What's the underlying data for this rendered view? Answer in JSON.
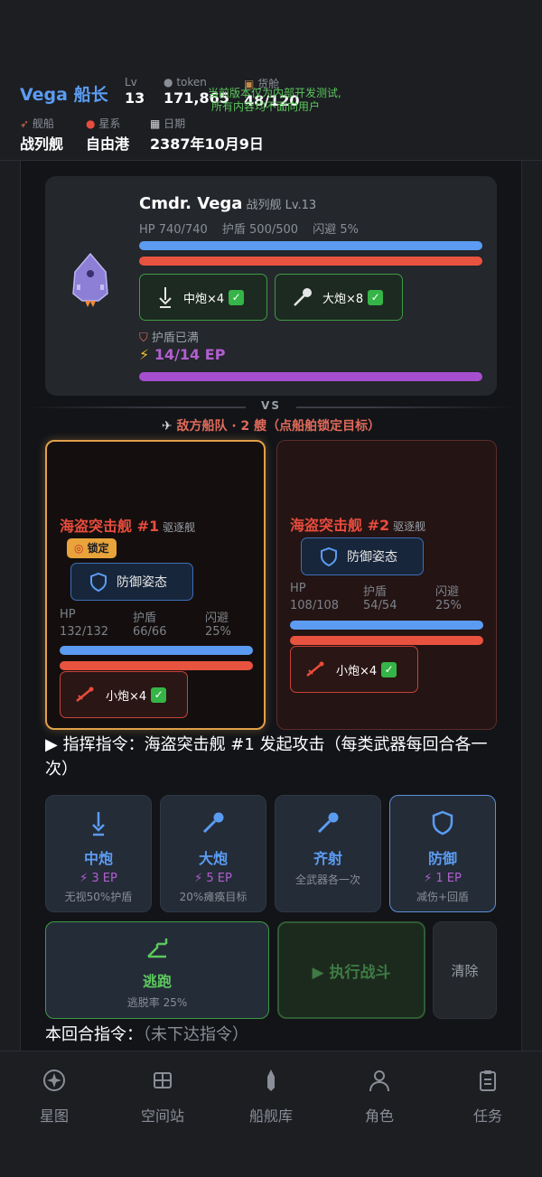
{
  "header": {
    "captain_name": "Vega 船长",
    "lv_label": "Lv",
    "lv_value": "13",
    "token_label": "token",
    "token_value": "171,865",
    "cargo_label": "货舱",
    "cargo_value": "48/120",
    "ship_label": "舰船",
    "ship_value": "战列舰",
    "system_label": "星系",
    "system_value": "自由港",
    "date_label": "日期",
    "date_value": "2387年10月9日",
    "notice_line1": "当前版本仅为内部开发测试,",
    "notice_line2": "所有内容均不面向用户"
  },
  "player": {
    "name": "Cmdr. Vega",
    "ship_info": "战列舰 Lv.13",
    "hp": "HP 740/740",
    "shield": "护盾 500/500",
    "evade": "闪避 5%",
    "hp_fraction": 1.0,
    "shield_fraction": 1.0,
    "weapons": [
      {
        "label": "中炮×4",
        "check": "✓"
      },
      {
        "label": "大炮×8",
        "check": "✓"
      }
    ],
    "shield_status": "护盾已满",
    "ep": "14/14 EP",
    "ep_fraction": 1.0
  },
  "vs_label": "VS",
  "enemy_header": "敌方船队 · 2 艘（点船舶锁定目标）",
  "enemies": [
    {
      "name": "海盗突击舰 #1",
      "class": "驱逐舰",
      "lock_label": "锁定",
      "stance": "防御姿态",
      "hp_label": "HP",
      "hp_value": "132/132",
      "shield_label": "护盾",
      "shield_value": "66/66",
      "evade_label": "闪避",
      "evade_value": "25%",
      "weapon": "小炮×4",
      "check": "✓"
    },
    {
      "name": "海盗突击舰 #2",
      "class": "驱逐舰",
      "stance": "防御姿态",
      "hp_label": "HP",
      "hp_value": "108/108",
      "shield_label": "护盾",
      "shield_value": "54/54",
      "evade_label": "闪避",
      "evade_value": "25%",
      "weapon": "小炮×4",
      "check": "✓"
    }
  ],
  "command_line": "▶ 指挥指令：海盗突击舰 #1 发起攻击（每类武器每回合各一次）",
  "actions": [
    {
      "title": "中炮",
      "cost": "⚡ 3 EP",
      "desc": "无视50%护盾",
      "icon": "medium-cannon-icon"
    },
    {
      "title": "大炮",
      "cost": "⚡ 5 EP",
      "desc": "20%瘫痪目标",
      "icon": "large-cannon-icon"
    },
    {
      "title": "齐射",
      "cost": "全武器各一次",
      "desc": "",
      "icon": "volley-icon"
    },
    {
      "title": "防御",
      "cost": "⚡ 1 EP",
      "desc": "减伤+回盾",
      "icon": "shield-icon"
    }
  ],
  "escape": {
    "title": "逃跑",
    "desc": "逃脱率 25%"
  },
  "execute_label": "▶ 执行战斗",
  "clear_label": "清除",
  "round_cmd_label": "本回合指令：",
  "round_cmd_value": "（未下达指令）",
  "nav": [
    {
      "label": "星图",
      "icon": "star-map-icon"
    },
    {
      "label": "空间站",
      "icon": "space-station-icon"
    },
    {
      "label": "船舰库",
      "icon": "shipyard-icon"
    },
    {
      "label": "角色",
      "icon": "character-icon"
    },
    {
      "label": "任务",
      "icon": "tasks-icon"
    }
  ],
  "colors": {
    "accent_blue": "#5b9cf2",
    "hp_bar": "#5b9cf2",
    "shield_bar": "#e8533f",
    "ep_bar": "#a54fcf",
    "lock_gold": "#e2a04b",
    "enemy_red": "#e84c3d",
    "ok_green": "#3e9a45"
  }
}
